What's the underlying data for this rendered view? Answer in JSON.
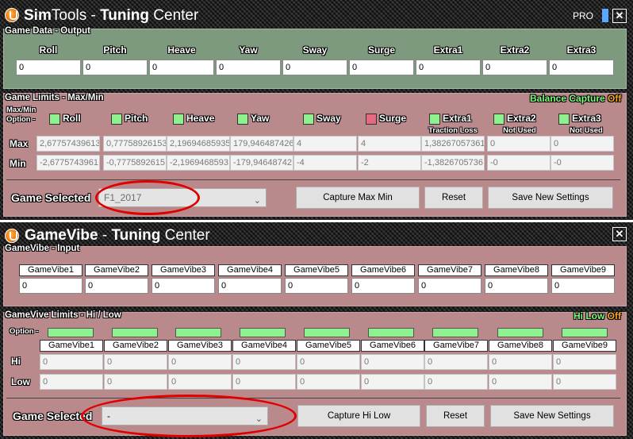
{
  "simtools": {
    "title_a": "Sim",
    "title_b": "Tools",
    "title_c": " - ",
    "title_d": "Tuning",
    "title_e": " Center",
    "pro_label": "PRO",
    "close_label": "✕",
    "game_data_label": "Game Data - Output",
    "axes": [
      "Roll",
      "Pitch",
      "Heave",
      "Yaw",
      "Sway",
      "Surge",
      "Extra1",
      "Extra2",
      "Extra3"
    ],
    "output_values": [
      "0",
      "0",
      "0",
      "0",
      "0",
      "0",
      "0",
      "0",
      "0"
    ],
    "game_limits_label": "Game Limits - Max/Min",
    "balance_capture_label_1": "Balance",
    "balance_capture_label_2": " Capture",
    "balance_capture_label_3": " Off",
    "maxmin_option_label_1": "Max/Min",
    "maxmin_option_label_2": "Option -",
    "option_states": [
      "green",
      "green",
      "green",
      "green",
      "green",
      "red",
      "green",
      "green",
      "green"
    ],
    "sublabels": [
      "",
      "",
      "",
      "",
      "",
      "",
      "Traction Loss",
      "Not Used",
      "Not Used"
    ],
    "max_label": "Max",
    "min_label": "Min",
    "max_values": [
      "2,67757439613",
      "0,77758926153",
      "2,19694685935",
      "179,946487426",
      "4",
      "4",
      "1,38267057361",
      "0",
      "0"
    ],
    "min_values": [
      "-2,6775743961",
      "-0,7775892615",
      "-2,1969468593",
      "-179,94648742",
      "-4",
      "-2",
      "-1,3826705736",
      "-0",
      "-0"
    ],
    "game_selected_label": "Game Selected",
    "game_selected_value": "F1_2017",
    "capture_button": "Capture Max Min",
    "reset_button": "Reset",
    "save_button": "Save New Settings"
  },
  "gamevibe": {
    "title_a": "GameVibe",
    "title_c": " - ",
    "title_d": "Tuning",
    "title_e": " Center",
    "close_label": "✕",
    "input_label": "GameVibe - Input",
    "channels": [
      "GameVibe1",
      "GameVibe2",
      "GameVibe3",
      "GameVibe4",
      "GameVibe5",
      "GameVibe6",
      "GameVibe7",
      "GameVibe8",
      "GameVibe9"
    ],
    "input_values": [
      "0",
      "0",
      "0",
      "0",
      "0",
      "0",
      "0",
      "0",
      "0"
    ],
    "limits_label": "GameVive Limits - Hi / Low",
    "hilow_label_1": "Hi",
    "hilow_label_2": " Low",
    "hilow_label_3": " Off",
    "option_label": "Option -",
    "hi_label": "Hi",
    "low_label": "Low",
    "hi_values": [
      "0",
      "0",
      "0",
      "0",
      "0",
      "0",
      "0",
      "0",
      "0"
    ],
    "low_values": [
      "0",
      "0",
      "0",
      "0",
      "0",
      "0",
      "0",
      "0",
      "0"
    ],
    "game_selected_label": "Game Selected",
    "game_selected_value": "-",
    "capture_button": "Capture Hi Low",
    "reset_button": "Reset",
    "save_button": "Save New Settings"
  },
  "colors": {
    "green_panel": "#7d9a7f",
    "red_panel": "#b9898b",
    "checkbox_on": "#8ef08e",
    "checkbox_red": "#e46a82",
    "highlight_oval": "#e00000",
    "toggle_green": "#7dfc7d",
    "toggle_orange": "#f5a623"
  }
}
